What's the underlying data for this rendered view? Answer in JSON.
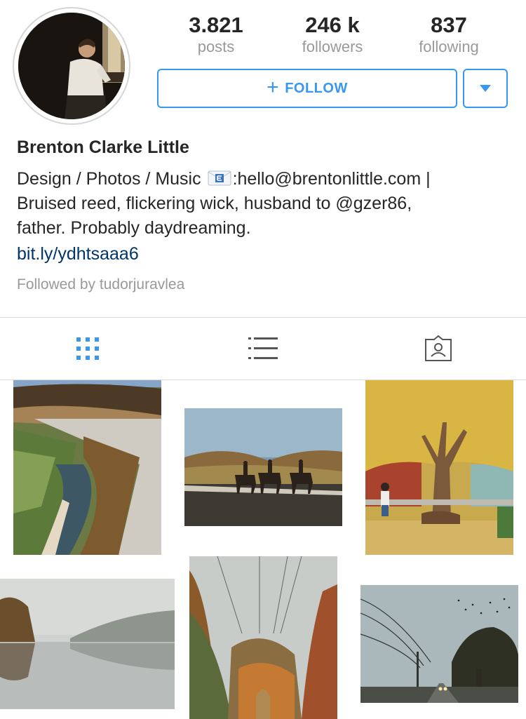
{
  "profile": {
    "stats": [
      {
        "number": "3.821",
        "label": "posts"
      },
      {
        "number": "246 k",
        "label": "followers"
      },
      {
        "number": "837",
        "label": "following"
      }
    ],
    "follow_label": "FOLLOW",
    "name": "Brenton Clarke Little",
    "bio_line1_before": "Design / Photos / Music",
    "bio_line1_after": ":hello@brentonlittle.com |",
    "bio_line2": "Bruised reed, flickering wick, husband to @gzer86,",
    "bio_line3": "father. Probably daydreaming.",
    "link": "bit.ly/ydhtsaaa6",
    "followed_by": "Followed by tudorjuravlea"
  },
  "tabs": [
    {
      "name": "grid-icon",
      "active": true
    },
    {
      "name": "list-icon",
      "active": false
    },
    {
      "name": "tagged-icon",
      "active": false
    }
  ],
  "colors": {
    "accent": "#3897f0",
    "link": "#003569",
    "secondary_text": "#999999",
    "primary_text": "#262626",
    "divider": "#dbdbdb"
  }
}
